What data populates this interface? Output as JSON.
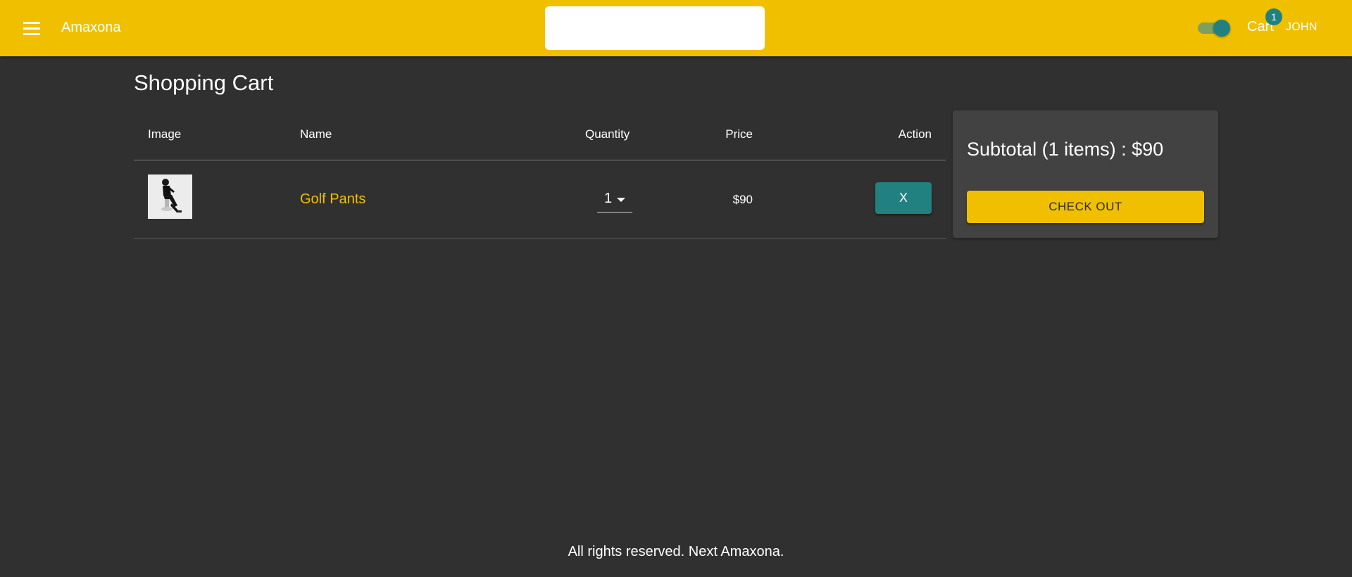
{
  "header": {
    "menu_icon": "menu-icon",
    "brand": "Amaxona",
    "search": {
      "value": "",
      "placeholder": ""
    },
    "theme_toggle": {
      "on": true
    },
    "cart_label": "Cart",
    "cart_count": "1",
    "user_label": "JOHN"
  },
  "page": {
    "title": "Shopping Cart"
  },
  "table": {
    "headers": {
      "image": "Image",
      "name": "Name",
      "quantity": "Quantity",
      "price": "Price",
      "action": "Action"
    },
    "rows": [
      {
        "name": "Golf Pants",
        "quantity": "1",
        "price": "$90",
        "action_label": "X"
      }
    ]
  },
  "summary": {
    "subtotal_text": "Subtotal (1 items) : $90",
    "checkout_label": "CHECK OUT"
  },
  "footer": {
    "text": "All rights reserved. Next Amaxona."
  },
  "colors": {
    "primary": "#f0c000",
    "secondary": "#218080",
    "background": "#303030",
    "card": "#424242"
  }
}
